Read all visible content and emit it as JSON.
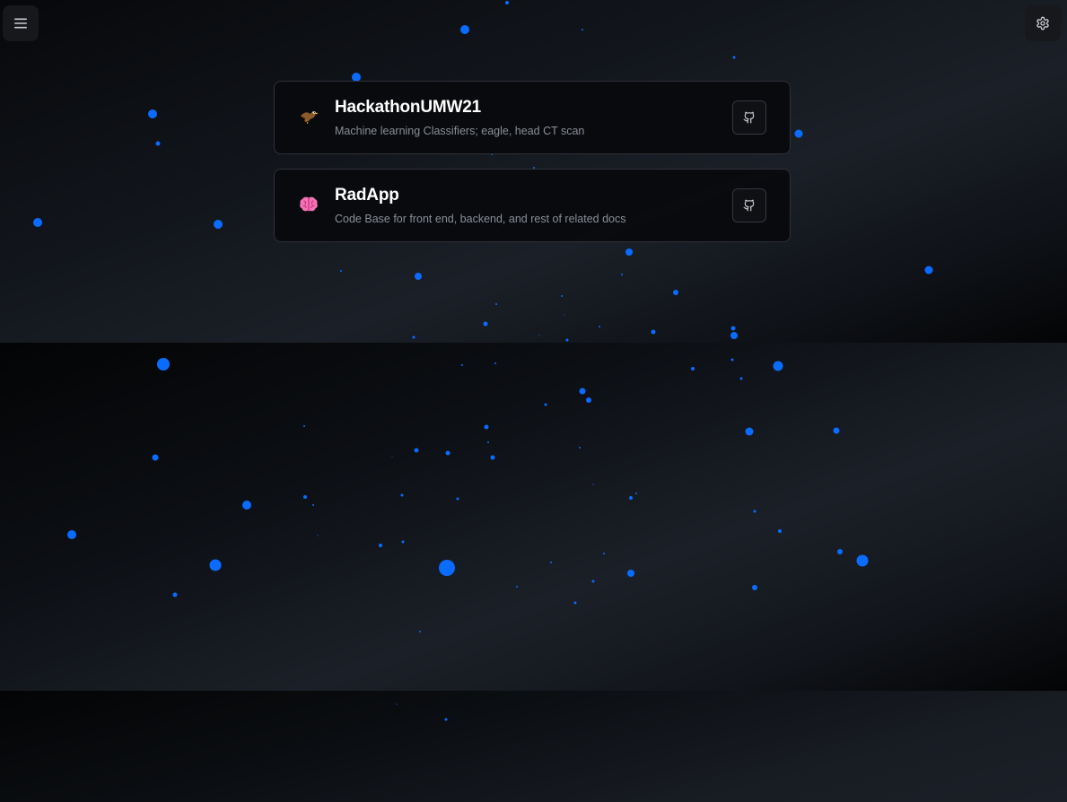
{
  "header": {
    "menu_icon": "hamburger-menu-icon",
    "settings_icon": "gear-icon"
  },
  "projects": [
    {
      "title": "HackathonUMW21",
      "description": "Machine learning Classifiers; eagle, head CT scan",
      "emoji": "eagle",
      "link_icon": "github-icon"
    },
    {
      "title": "RadApp",
      "description": "Code Base for front end, backend, and rest of related docs",
      "emoji": "brain",
      "link_icon": "github-icon"
    }
  ],
  "colors": {
    "particle": "#0a6cff",
    "card_border": "#2e3138",
    "card_bg": "#0a0b0e",
    "title": "#ffffff",
    "description": "#8a8f98"
  }
}
